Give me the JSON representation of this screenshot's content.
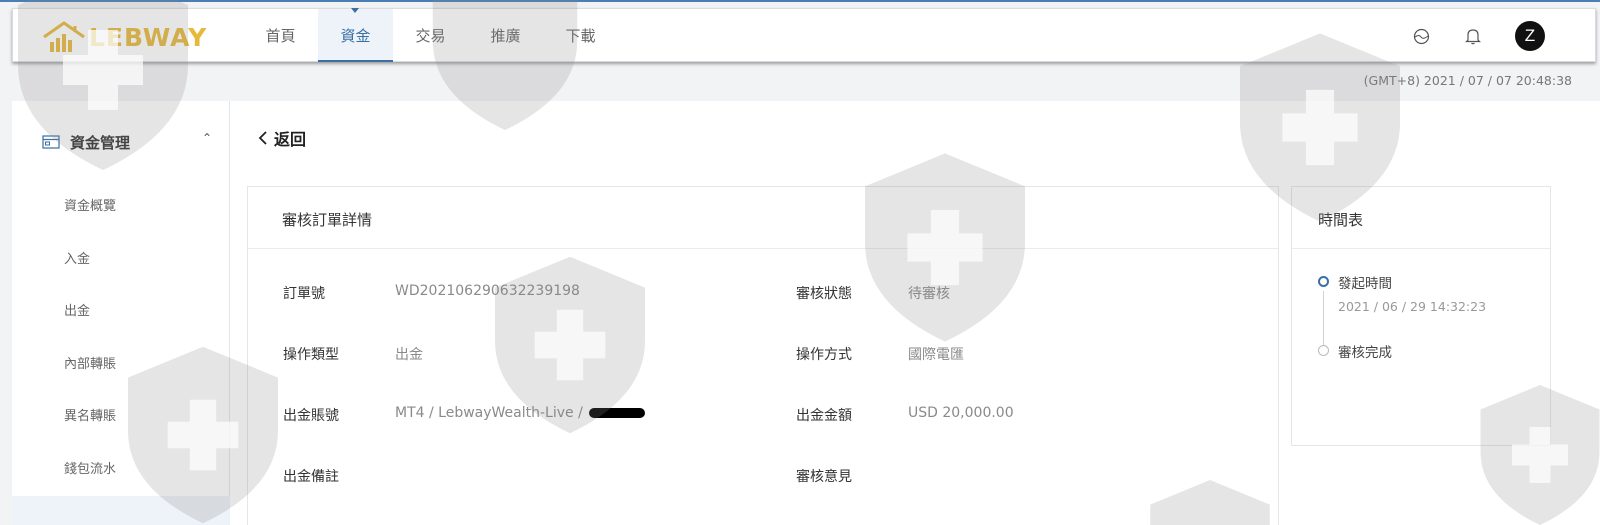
{
  "brand": {
    "logo_text": "LEBWAY",
    "color": "#e6b93a"
  },
  "nav": {
    "items": [
      {
        "label": "首頁"
      },
      {
        "label": "資金",
        "active": true
      },
      {
        "label": "交易"
      },
      {
        "label": "推廣"
      },
      {
        "label": "下載"
      }
    ],
    "icons": [
      "globe-icon",
      "bell-icon"
    ],
    "avatar_letter": "Z"
  },
  "timestamp": "(GMT+8) 2021 / 07 / 07 20:48:38",
  "sidebar": {
    "section_label": "資金管理",
    "items": [
      {
        "label": "資金概覽"
      },
      {
        "label": "入金"
      },
      {
        "label": "出金"
      },
      {
        "label": "內部轉賬"
      },
      {
        "label": "異名轉賬"
      },
      {
        "label": "錢包流水"
      }
    ]
  },
  "page": {
    "back_label": "返回"
  },
  "order_card": {
    "title": "審核訂單詳情",
    "fields": {
      "order_no": {
        "label": "訂單號",
        "value": "WD20210629063223919​8"
      },
      "review_status": {
        "label": "審核狀態",
        "value": "待審核"
      },
      "op_type": {
        "label": "操作類型",
        "value": "出金"
      },
      "op_method": {
        "label": "操作方式",
        "value": "國際電匯"
      },
      "account": {
        "label": "出金賬號",
        "value": "MT4 / LebwayWealth-Live /"
      },
      "amount": {
        "label": "出金金額",
        "value": "USD 20,000.00"
      },
      "remark": {
        "label": "出金備註",
        "value": ""
      },
      "opinion": {
        "label": "審核意見",
        "value": ""
      }
    }
  },
  "timeline": {
    "title": "時間表",
    "events": [
      {
        "title": "發起時間",
        "time": "2021 / 06 / 29 14:32:23"
      },
      {
        "title": "審核完成",
        "time": ""
      }
    ]
  },
  "colors": {
    "accent": "#3b6fa3",
    "topline": "#4a7fb5"
  }
}
